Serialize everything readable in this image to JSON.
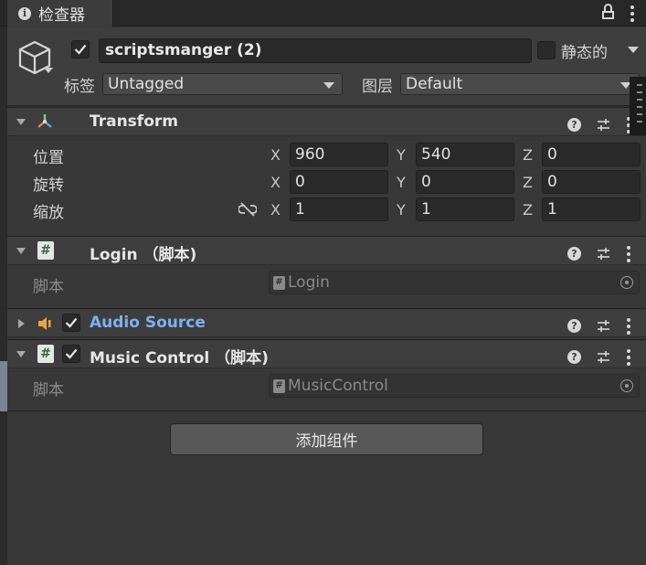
{
  "window": {
    "tab_label": "检查器",
    "info_icon": "i"
  },
  "object": {
    "active": true,
    "name": "scriptsmanger (2)",
    "static_label": "静态的",
    "static_checked": false,
    "tag_label": "标签",
    "tag_value": "Untagged",
    "layer_label": "图层",
    "layer_value": "Default"
  },
  "transform": {
    "title": "Transform",
    "rows": [
      {
        "label": "位置",
        "x": "960",
        "y": "540",
        "z": "0"
      },
      {
        "label": "旋转",
        "x": "0",
        "y": "0",
        "z": "0"
      },
      {
        "label": "缩放",
        "x": "1",
        "y": "1",
        "z": "1"
      }
    ],
    "axis_x": "X",
    "axis_y": "Y",
    "axis_z": "Z"
  },
  "login": {
    "title": "Login （脚本)",
    "script_label": "脚本",
    "script_value": "Login"
  },
  "audio": {
    "title": "Audio Source",
    "enabled": true,
    "title_color": "#7fb0f0"
  },
  "music": {
    "title": "Music Control （脚本)",
    "enabled": true,
    "script_label": "脚本",
    "script_value": "MusicControl"
  },
  "add_component_label": "添加组件",
  "icons": {
    "help": "?",
    "script": "#"
  }
}
